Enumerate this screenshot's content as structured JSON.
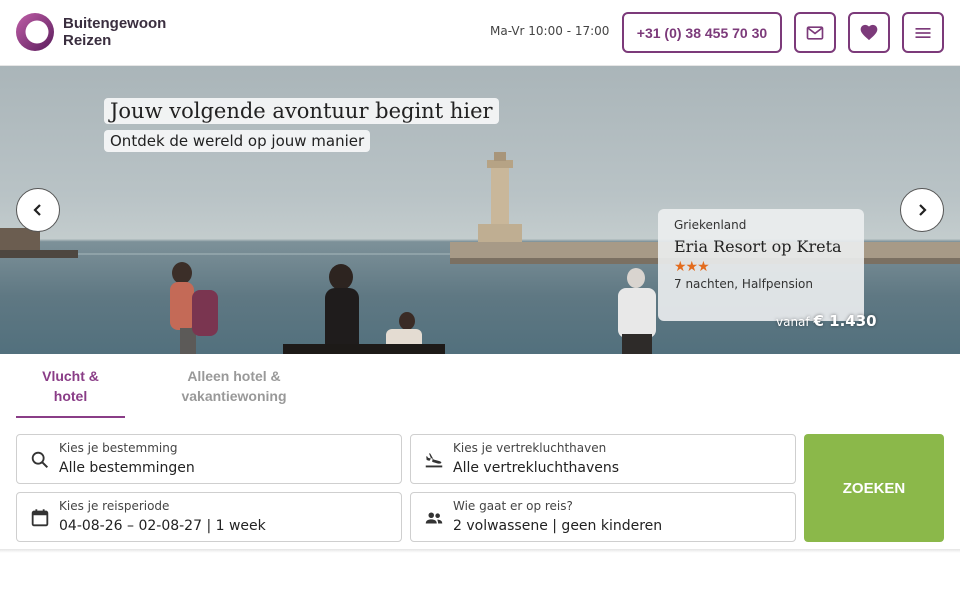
{
  "header": {
    "logo_line1": "Buitengewoon",
    "logo_line2": "Reizen",
    "hours": "Ma-Vr 10:00 - 17:00",
    "phone_label": "+31 (0) 38 455 70 30",
    "icons": [
      "mail-icon",
      "heart-icon",
      "menu-icon"
    ],
    "accent_color": "#7c3a7a"
  },
  "hero": {
    "title": "Jouw volgende avontuur begint hier",
    "subtitle": "Ontdek de wereld op jouw manier",
    "card": {
      "country": "Griekenland",
      "name": "Eria Resort op Kreta",
      "stars": 3,
      "star_glyphs": "★★★",
      "nights": "7 nachten, Halfpension",
      "price_prefix": "vanaf",
      "price": "€ 1.430"
    }
  },
  "tabs": [
    {
      "label": "Vlucht & hotel",
      "line1": "Vlucht &",
      "line2": "hotel",
      "active": true
    },
    {
      "label": "Alleen hotel & vakantiewoning",
      "line1": "Alleen hotel &",
      "line2": "vakantiewoning",
      "active": false
    }
  ],
  "search": {
    "destination": {
      "label": "Kies je bestemming",
      "value": "Alle bestemmingen"
    },
    "airport": {
      "label": "Kies je vertrekluchthaven",
      "value": "Alle vertrekluchthavens"
    },
    "period": {
      "label": "Kies je reisperiode",
      "value": "04-08-26 – 02-08-27 | 1 week"
    },
    "travelers": {
      "label": "Wie gaat er op reis?",
      "value": "2 volwassene | geen kinderen"
    },
    "button_label": "ZOEKEN",
    "button_color": "#8bb84a"
  }
}
